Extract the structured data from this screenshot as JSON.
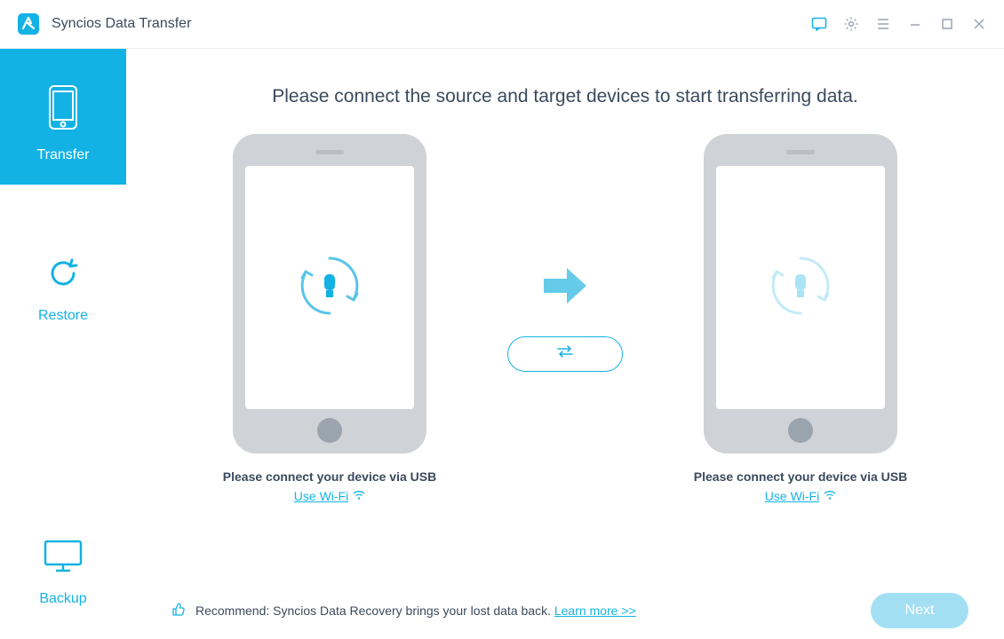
{
  "app": {
    "title": "Syncios Data Transfer"
  },
  "sidebar": {
    "items": [
      {
        "label": "Transfer"
      },
      {
        "label": "Restore"
      },
      {
        "label": "Backup"
      }
    ]
  },
  "main": {
    "headline": "Please connect the source and target devices to start transferring data.",
    "source": {
      "instruction": "Please connect your device via USB",
      "wifi_label": "Use Wi-Fi"
    },
    "target": {
      "instruction": "Please connect your device via USB",
      "wifi_label": "Use Wi-Fi"
    }
  },
  "footer": {
    "recommend_text": "Recommend: Syncios Data Recovery brings your lost data back. ",
    "learn_more": "Learn more >>",
    "next_label": "Next"
  }
}
